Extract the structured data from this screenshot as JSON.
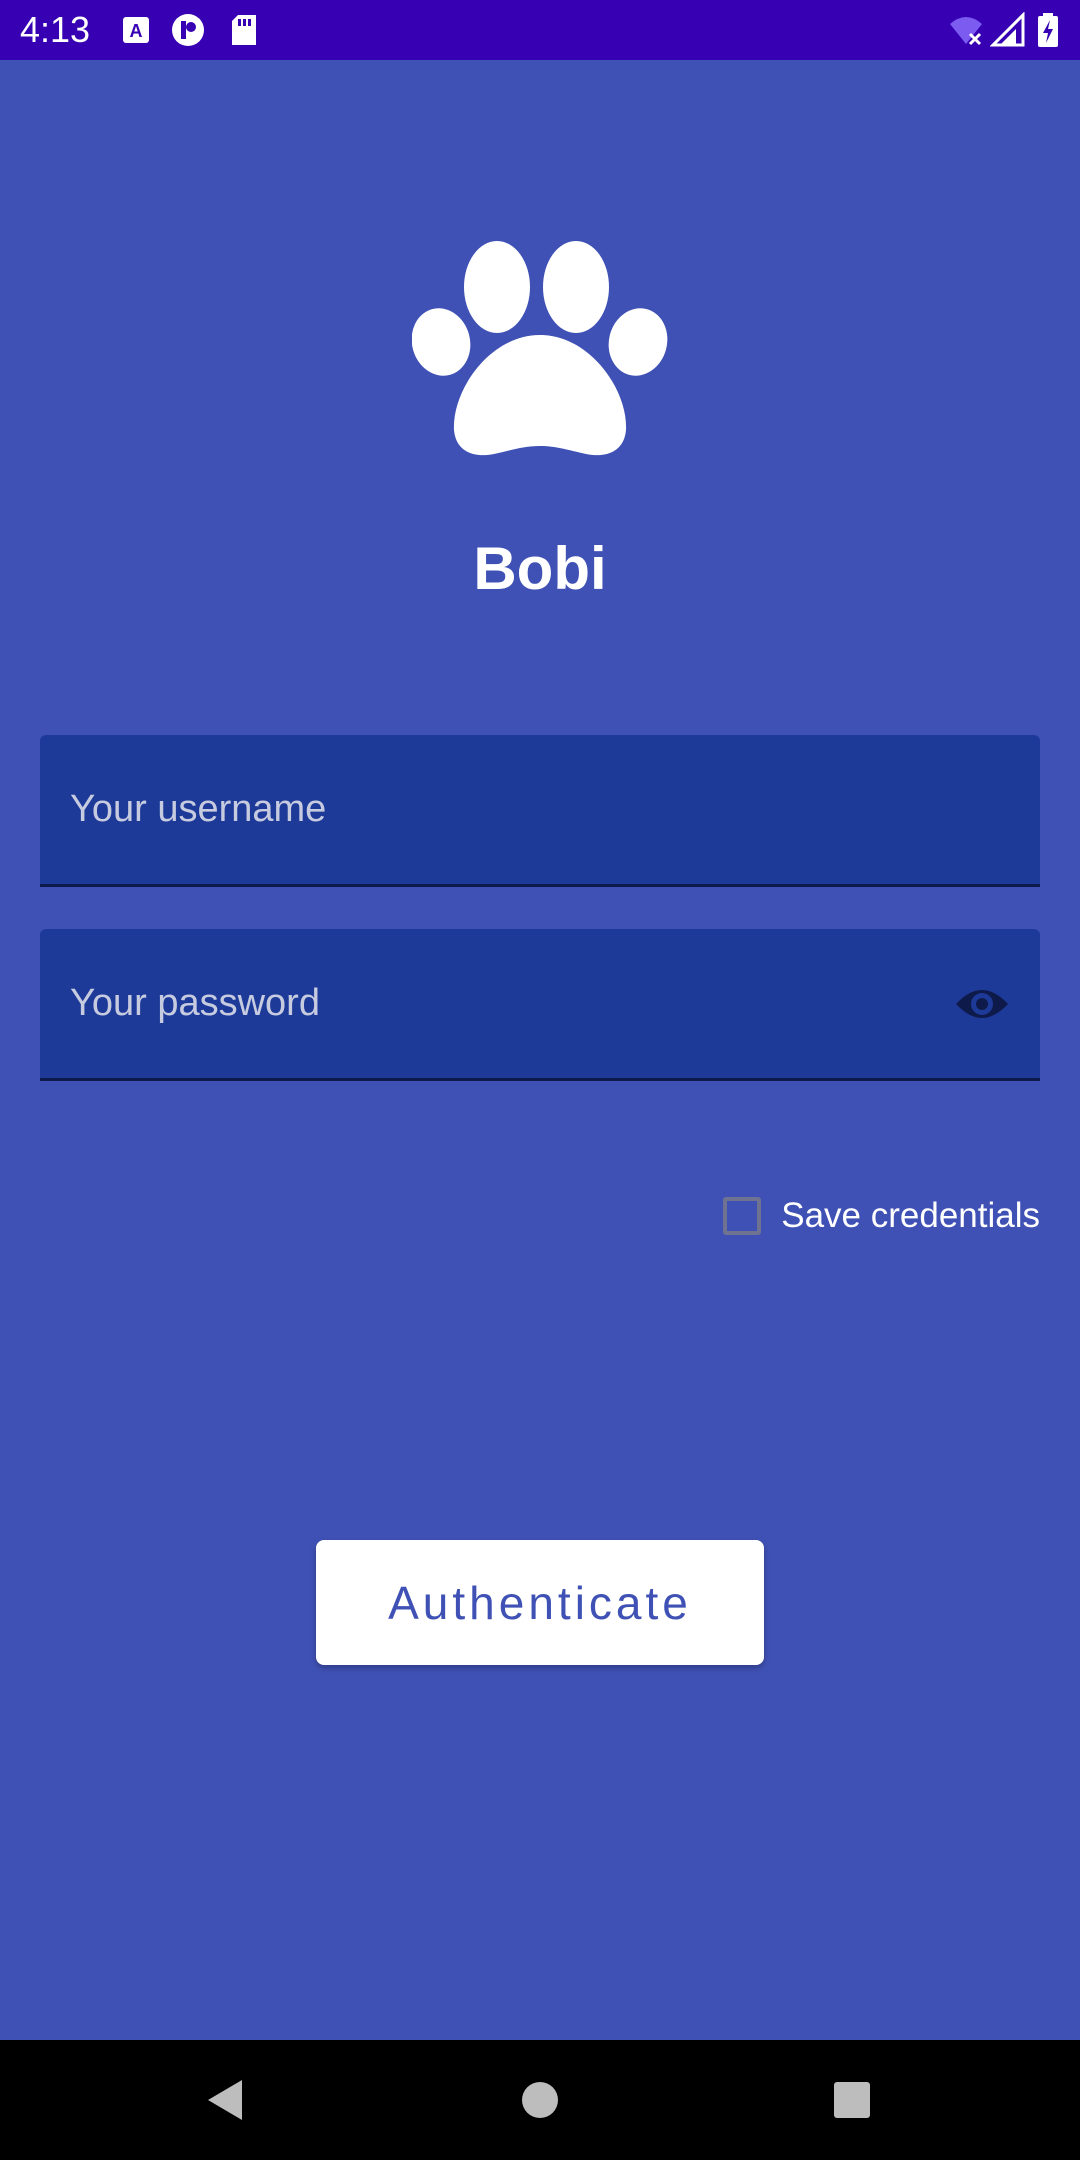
{
  "status_bar": {
    "time": "4:13",
    "icons": [
      "a-icon",
      "p-circle-icon",
      "sd-card-icon",
      "wifi-off-icon",
      "cell-signal-icon",
      "battery-charging-icon"
    ]
  },
  "app": {
    "logo_icon": "paw-icon",
    "title": "Bobi"
  },
  "form": {
    "username_placeholder": "Your username",
    "username_value": "",
    "password_placeholder": "Your password",
    "password_value": "",
    "password_toggle_icon": "eye-icon",
    "save_credentials_label": "Save credentials",
    "save_credentials_checked": false,
    "submit_label": "Authenticate"
  },
  "nav_bar": {
    "buttons": [
      "back-icon",
      "home-icon",
      "recents-icon"
    ]
  },
  "colors": {
    "background": "#3f51b5",
    "status_bar": "#3700b3",
    "field_background": "#1d3a99",
    "button_text": "#3f51b5",
    "eye_icon": "#0e1b4a"
  }
}
